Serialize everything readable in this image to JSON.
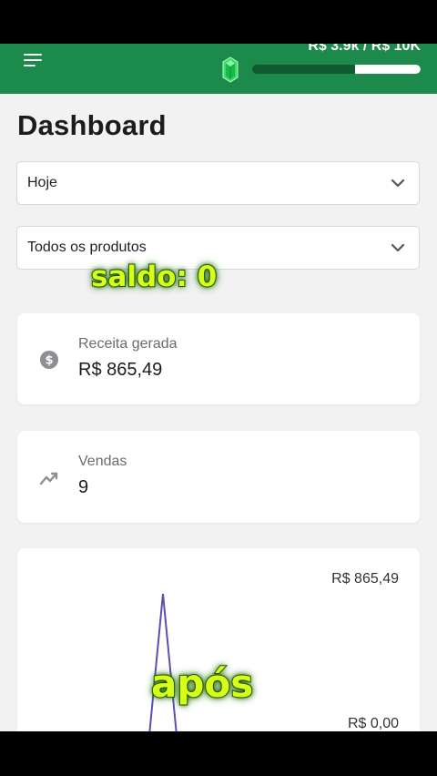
{
  "header": {
    "progress_label": "R$ 3.9k / R$ 10K",
    "progress_fraction": 0.39,
    "accent_color": "#1b8a4a",
    "gem_icon": "emerald-gem-icon",
    "menu_icon": "hamburger-menu-icon"
  },
  "page": {
    "title": "Dashboard"
  },
  "filters": {
    "period": {
      "value": "Hoje"
    },
    "product": {
      "value": "Todos os produtos"
    }
  },
  "cards": {
    "revenue": {
      "label": "Receita gerada",
      "value": "R$ 865,49",
      "icon": "dollar-coin-icon"
    },
    "sales": {
      "label": "Vendas",
      "value": "9",
      "icon": "trending-up-icon"
    }
  },
  "chart_data": {
    "type": "line",
    "y_max_label": "R$ 865,49",
    "y_min_label": "R$ 0,00",
    "x": [
      0,
      1,
      2
    ],
    "values": [
      0,
      865.49,
      0
    ],
    "ylim": [
      0,
      865.49
    ],
    "line_color": "#5b4fb3"
  },
  "overlay": {
    "caption_top": "saldo: 0",
    "caption_bottom": "após"
  }
}
